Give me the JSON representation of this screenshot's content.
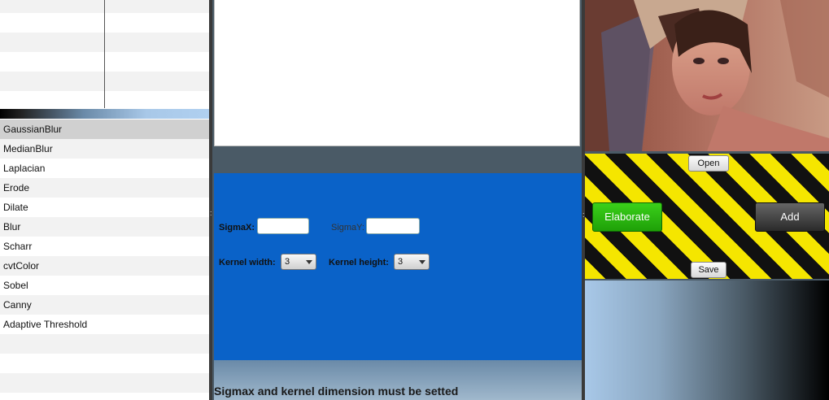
{
  "operations": [
    "GaussianBlur",
    "MedianBlur",
    "Laplacian",
    "Erode",
    "Dilate",
    "Blur",
    "Scharr",
    "cvtColor",
    "Sobel",
    "Canny",
    "Adaptive Threshold"
  ],
  "params": {
    "sigma_x_label": "SigmaX:",
    "sigma_y_label": "SigmaY:",
    "kernel_width_label": "Kernel width:",
    "kernel_height_label": "Kernel height:",
    "kernel_width_value": "3",
    "kernel_height_value": "3",
    "sigma_x_value": "",
    "sigma_y_value": ""
  },
  "status_message": "Sigmax and kernel dimension must be setted",
  "buttons": {
    "open": "Open",
    "elaborate": "Elaborate",
    "add": "Add",
    "save": "Save"
  },
  "colors": {
    "params_panel": "#0a62c8",
    "elaborate": "#2ab810",
    "hazard_yellow": "#f5e600"
  }
}
